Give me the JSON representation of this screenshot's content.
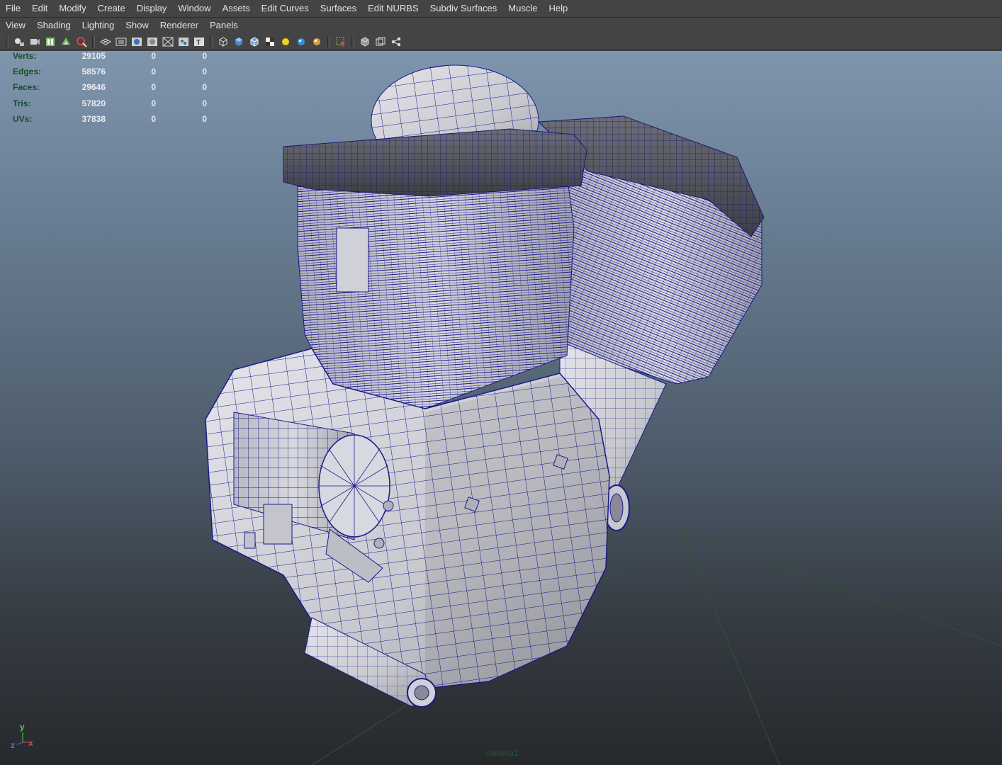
{
  "menu_bar": {
    "items": [
      "File",
      "Edit",
      "Modify",
      "Create",
      "Display",
      "Window",
      "Assets",
      "Edit Curves",
      "Surfaces",
      "Edit NURBS",
      "Subdiv Surfaces",
      "Muscle",
      "Help"
    ]
  },
  "panel_menu": {
    "items": [
      "View",
      "Shading",
      "Lighting",
      "Show",
      "Renderer",
      "Panels"
    ]
  },
  "toolbar": {
    "icons": [
      "camera-select-icon",
      "camera-attributes-icon",
      "bookmarks-icon",
      "image-plane-icon",
      "grease-pencil-icon",
      "grid-icon",
      "film-gate-icon",
      "resolution-gate-icon",
      "gate-mask-icon",
      "field-chart-icon",
      "safe-action-icon",
      "safe-title-icon",
      "wireframe-icon",
      "smooth-shade-icon",
      "wireframe-on-shaded-icon",
      "textured-icon",
      "default-light-icon",
      "all-lights-icon",
      "shadows-icon",
      "isolate-select-icon",
      "xray-icon",
      "xray-joints-icon",
      "backface-icon"
    ]
  },
  "heads_up_display": {
    "rows": [
      {
        "label": "Verts:",
        "values": [
          "29105",
          "0",
          "0"
        ]
      },
      {
        "label": "Edges:",
        "values": [
          "58576",
          "0",
          "0"
        ]
      },
      {
        "label": "Faces:",
        "values": [
          "29646",
          "0",
          "0"
        ]
      },
      {
        "label": "Tris:",
        "values": [
          "57820",
          "0",
          "0"
        ]
      },
      {
        "label": "UVs:",
        "values": [
          "37838",
          "0",
          "0"
        ]
      }
    ]
  },
  "viewport": {
    "camera_label": "camera1",
    "axis": {
      "x": "x",
      "y": "y",
      "z": "z"
    },
    "colors": {
      "wire": "#1a1a8c",
      "hud_label": "#1b4d25",
      "hud_value": "#e9eaf0",
      "grid_line": "#2a5a2a"
    }
  }
}
